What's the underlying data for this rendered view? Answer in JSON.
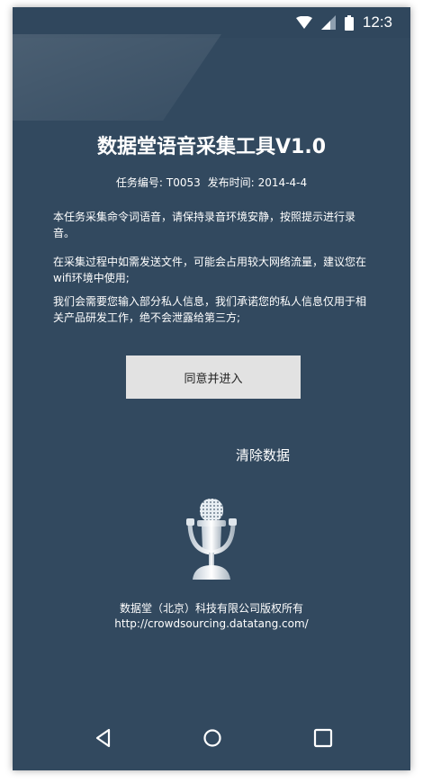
{
  "status": {
    "time": "12:3"
  },
  "header": {
    "title": "数据堂语音采集工具V1.0"
  },
  "task": {
    "number_label": "任务编号:",
    "number": "T0053",
    "date_label": "发布时间:",
    "date": "2014-4-4"
  },
  "notices": [
    "本任务采集命令词语音，请保持录音环境安静，按照提示进行录音。",
    "在采集过程中如需发送文件，可能会占用较大网络流量，建议您在wifi环境中使用;",
    "我们会需要您输入部分私人信息，我们承诺您的私人信息仅用于相关产品研发工作，绝不会泄露给第三方;"
  ],
  "actions": {
    "agree": "同意并进入",
    "clear": "清除数据"
  },
  "footer": {
    "copyright": "数据堂（北京）科技有限公司版权所有",
    "url": "http://crowdsourcing.datatang.com/"
  },
  "icons": {
    "wifi": "wifi-icon",
    "signal": "signal-icon",
    "battery": "battery-icon",
    "mic": "microphone-icon",
    "back": "back-icon",
    "home": "home-icon",
    "recents": "recents-icon"
  }
}
